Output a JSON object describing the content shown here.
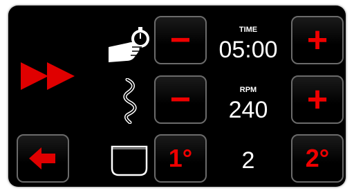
{
  "play_icon": "fast-forward-icon",
  "back_button": {
    "icon": "arrow-left-icon"
  },
  "time": {
    "label": "TIME",
    "value": "05:00",
    "minus": "−",
    "plus": "+"
  },
  "rpm": {
    "label": "RPM",
    "value": "240",
    "minus": "−",
    "plus": "+"
  },
  "level": {
    "value": "2",
    "left": "1°",
    "right": "2°"
  },
  "colors": {
    "accent": "#e00000",
    "background": "#000000",
    "text": "#ffffff",
    "border": "#6b6b6b"
  }
}
